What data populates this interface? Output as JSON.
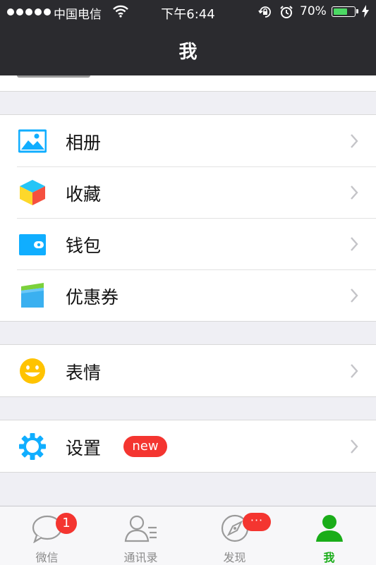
{
  "status_bar": {
    "carrier": "中国电信",
    "time": "下午6:44",
    "battery": "70%",
    "battery_level": 0.7
  },
  "header": {
    "title": "我"
  },
  "menu": {
    "group1": [
      {
        "label": "相册",
        "icon": "photo-album-icon"
      },
      {
        "label": "收藏",
        "icon": "favorites-cube-icon"
      },
      {
        "label": "钱包",
        "icon": "wallet-icon"
      },
      {
        "label": "优惠券",
        "icon": "coupon-icon"
      }
    ],
    "group2": [
      {
        "label": "表情",
        "icon": "smiley-icon"
      }
    ],
    "group3": [
      {
        "label": "设置",
        "icon": "gear-icon",
        "badge": "new"
      }
    ]
  },
  "tabbar": {
    "tabs": [
      {
        "label": "微信",
        "icon": "chat-bubble-icon",
        "badge": "1"
      },
      {
        "label": "通讯录",
        "icon": "contacts-icon"
      },
      {
        "label": "发现",
        "icon": "compass-icon",
        "badge": "···"
      },
      {
        "label": "我",
        "icon": "person-icon",
        "active": true
      }
    ]
  },
  "colors": {
    "header_bg": "#2b2b2f",
    "accent_green": "#1aad19",
    "badge_red": "#f43530",
    "icon_blue": "#10aeff"
  }
}
